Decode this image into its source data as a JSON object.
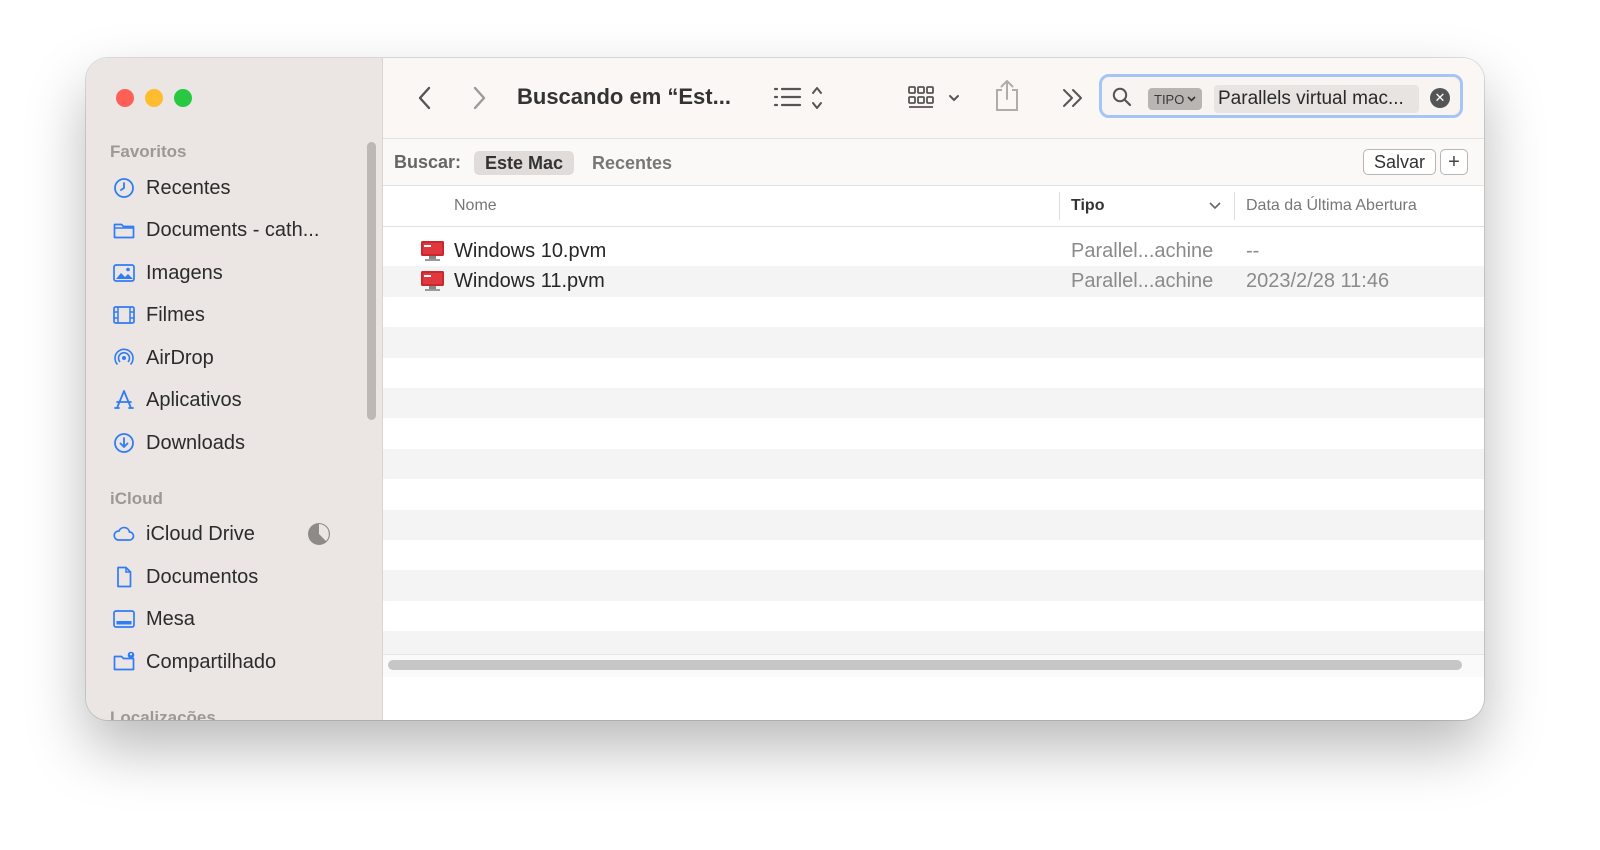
{
  "window": {
    "title": "Buscando em “Est..."
  },
  "sidebar": {
    "sections": [
      {
        "label": "Favoritos"
      },
      {
        "label": "iCloud"
      },
      {
        "label": "Localizações"
      }
    ],
    "items": [
      {
        "label": "Recentes",
        "icon": "clock-icon"
      },
      {
        "label": "Documents - cath...",
        "icon": "folder-icon"
      },
      {
        "label": "Imagens",
        "icon": "photo-icon"
      },
      {
        "label": "Filmes",
        "icon": "film-icon"
      },
      {
        "label": "AirDrop",
        "icon": "airdrop-icon"
      },
      {
        "label": "Aplicativos",
        "icon": "apps-icon"
      },
      {
        "label": "Downloads",
        "icon": "download-icon"
      },
      {
        "label": "iCloud Drive",
        "icon": "cloud-icon"
      },
      {
        "label": "Documentos",
        "icon": "document-icon"
      },
      {
        "label": "Mesa",
        "icon": "desktop-icon"
      },
      {
        "label": "Compartilhado",
        "icon": "shared-folder-icon"
      }
    ]
  },
  "search": {
    "token": "TIPO",
    "query": "Parallels virtual mac..."
  },
  "scope": {
    "label": "Buscar:",
    "options": [
      "Este Mac",
      "Recentes"
    ],
    "selected": "Este Mac",
    "save_label": "Salvar",
    "add_label": "+"
  },
  "table": {
    "columns": [
      "Nome",
      "Tipo",
      "Data da Última Abertura"
    ],
    "rows": [
      {
        "name": "Windows 10.pvm",
        "kind": "Parallel...achine",
        "date": "--"
      },
      {
        "name": "Windows 11.pvm",
        "kind": "Parallel...achine",
        "date": "2023/2/28 11:46"
      }
    ]
  },
  "colors": {
    "accent": "#2f7cf6",
    "sidebar_bg": "#ebe6e3",
    "search_focus": "#a6c4f6"
  }
}
